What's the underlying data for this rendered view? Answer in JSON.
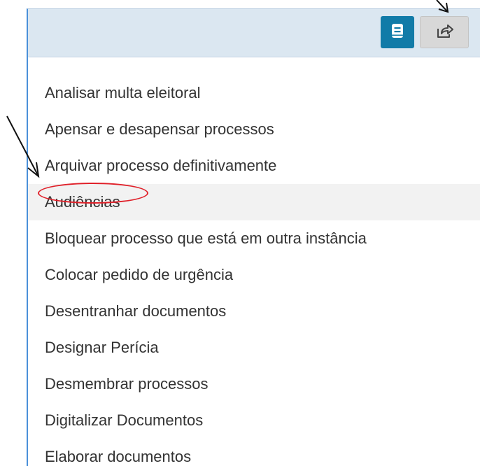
{
  "toolbar": {
    "book_icon": "book-icon",
    "share_icon": "share-icon"
  },
  "menu": {
    "items": [
      {
        "label": "Analisar multa eleitoral"
      },
      {
        "label": "Apensar e desapensar processos"
      },
      {
        "label": "Arquivar processo definitivamente"
      },
      {
        "label": "Audiências"
      },
      {
        "label": "Bloquear processo que está em outra instância"
      },
      {
        "label": "Colocar pedido de urgência"
      },
      {
        "label": "Desentranhar documentos"
      },
      {
        "label": "Designar Perícia"
      },
      {
        "label": "Desmembrar processos"
      },
      {
        "label": "Digitalizar Documentos"
      },
      {
        "label": "Elaborar documentos"
      }
    ],
    "hovered_index": 3
  },
  "colors": {
    "accent": "#117ba8",
    "toolbar_bg": "#dbe7f1",
    "annotation_red": "#e0212a",
    "panel_border": "#4a90d9"
  }
}
